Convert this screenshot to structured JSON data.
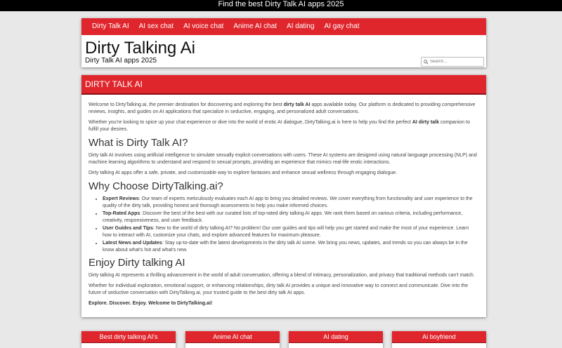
{
  "banner": "Find the best Dirty Talk AI apps 2025",
  "nav": [
    "Dirty Talk AI",
    "AI sex chat",
    "AI voice chat",
    "Anime AI chat",
    "AI dating",
    "AI gay chat"
  ],
  "site": {
    "title": "Dirty Talking Ai",
    "tagline": "Dirty Talk AI apps 2025"
  },
  "search": {
    "placeholder": "Search..."
  },
  "main": {
    "heading": "DIRTY TALK AI",
    "intro1_a": "Welcome to DirtyTalking.ai, the premier destination for discovering and exploring the best ",
    "intro1_b": "dirty talk AI",
    "intro1_c": " apps available today. Our platform is dedicated to providing comprehensive reviews, insights, and guides on AI applications that specialize in seductive, engaging, and personalized adult conversations.",
    "intro2_a": "Whether you're looking to spice up your chat experience or dive into the world of erotic AI dialogue, DirtyTalking.ai is here to help you find the perfect ",
    "intro2_b": "AI dirty talk",
    "intro2_c": " companion to fulfill your desires.",
    "h_what": "What is Dirty Talk AI?",
    "what1": "Dirty talk AI involves using artificial intelligence to simulate sexually explicit conversations with users. These AI systems are designed using natural language processing (NLP) and machine learning algorithms to understand and respond to sexual prompts, providing an experience that mimics real-life erotic interactions.",
    "what2": "Dirty talking AI apps offer a safe, private, and customizable way to explore fantasies and enhance sexual wellness through engaging dialogue.",
    "h_why": "Why Choose DirtyTalking.ai?",
    "why": [
      {
        "label": "Expert Reviews",
        "text": ": Our team of experts meticulously evaluates each AI app to bring you detailed reviews. We cover everything from functionality and user experience to the quality of the dirty talk, providing honest and thorough assessments to help you make informed choices."
      },
      {
        "label": "Top-Rated Apps",
        "text": ": Discover the best of the best with our curated lists of top-rated dirty talking AI apps. We rank them based on various criteria, including performance, creativity, responsiveness, and user feedback."
      },
      {
        "label": "User Guides and Tips",
        "text": ": New to the world of dirty talking AI? No problem! Our user guides and tips will help you get started and make the most of your experience. Learn how to interact with AI, customize your chats, and explore advanced features for maximum pleasure."
      },
      {
        "label": "Latest News and Updates",
        "text": ": Stay up-to-date with the latest developments in the dirty talk AI scene. We bring you news, updates, and trends so you can always be in the know about what's hot and what's new."
      }
    ],
    "h_enjoy": "Enjoy Dirty talking AI",
    "enjoy1": "Dirty talking AI represents a thrilling advancement in the world of adult conversation, offering a blend of intimacy, personalization, and privacy that traditional methods can't match.",
    "enjoy2": "Whether for individual exploration, emotional support, or enhancing relationships, dirty talk AI provides a unique and innovative way to connect and communicate. Dive into the future of seductive conversation with DirtyTalking.ai, your trusted guide to the best dirty talk AI apps.",
    "closing": "Explore. Discover. Enjoy. Welcome to DirtyTalking.ai!"
  },
  "cards": [
    "Best dirty talking AI's",
    "Anime AI chat",
    "AI dating",
    "Ai boyfriend"
  ],
  "colors": {
    "accent": "#e0262d",
    "accent_dark": "#8e1014"
  }
}
